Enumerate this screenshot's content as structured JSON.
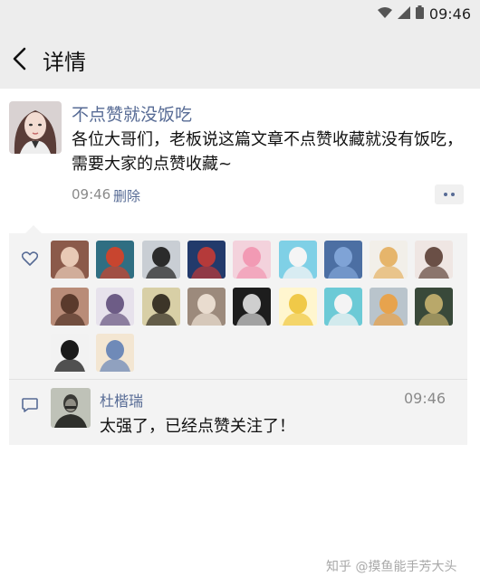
{
  "status_bar": {
    "time": "09:46",
    "icons": [
      "wifi-icon",
      "signal-icon",
      "battery-icon"
    ]
  },
  "header": {
    "title": "详情",
    "back_icon": "chevron-left-icon"
  },
  "post": {
    "author": "不点赞就没饭吃",
    "content": "各位大哥们，老板说这篇文章不点赞收藏就没有饭吃，需要大家的点赞收藏~",
    "time": "09:46",
    "delete_label": "删除",
    "more_icon": "more-dots-icon"
  },
  "likes": {
    "icon": "heart-icon",
    "likers": [
      {
        "name": "liker-1",
        "bg": "#8b5a4a",
        "fg": "#e8c9b5"
      },
      {
        "name": "liker-2",
        "bg": "#2f6e82",
        "fg": "#c8452f"
      },
      {
        "name": "liker-3",
        "bg": "#c9ced4",
        "fg": "#2b2b2b"
      },
      {
        "name": "liker-4",
        "bg": "#223a6b",
        "fg": "#b53a3a"
      },
      {
        "name": "liker-5",
        "bg": "#f3d2dc",
        "fg": "#f29ab4"
      },
      {
        "name": "liker-6",
        "bg": "#7fd0e6",
        "fg": "#f5f5f5"
      },
      {
        "name": "liker-7",
        "bg": "#4c6fa3",
        "fg": "#7fa3d6"
      },
      {
        "name": "liker-8",
        "bg": "#f2efe9",
        "fg": "#e6b56b"
      },
      {
        "name": "liker-9",
        "bg": "#efe6e3",
        "fg": "#6a4f46"
      },
      {
        "name": "liker-10",
        "bg": "#b98c78",
        "fg": "#5a3a2c"
      },
      {
        "name": "liker-11",
        "bg": "#e7e2ec",
        "fg": "#6d5c86"
      },
      {
        "name": "liker-12",
        "bg": "#d8cfa6",
        "fg": "#3c3528"
      },
      {
        "name": "liker-13",
        "bg": "#9c8a7c",
        "fg": "#e9dccf"
      },
      {
        "name": "liker-14",
        "bg": "#1d1d1d",
        "fg": "#cfcfcf"
      },
      {
        "name": "liker-15",
        "bg": "#fff6cf",
        "fg": "#f0c948"
      },
      {
        "name": "liker-16",
        "bg": "#6ccad6",
        "fg": "#f4f4f4"
      },
      {
        "name": "liker-17",
        "bg": "#b9c4cc",
        "fg": "#e7a34d"
      },
      {
        "name": "liker-18",
        "bg": "#39493a",
        "fg": "#b9a86a"
      },
      {
        "name": "liker-19",
        "bg": "#f2f2f2",
        "fg": "#1a1a1a"
      },
      {
        "name": "liker-20",
        "bg": "#f3e6d2",
        "fg": "#6f8ab8"
      }
    ]
  },
  "comment": {
    "icon": "comment-bubble-icon",
    "author": "杜楷瑞",
    "time": "09:46",
    "text": "太强了，已经点赞关注了！"
  },
  "watermark": "知乎 @摸鱼能手芳大头",
  "colors": {
    "link": "#576b95",
    "panel": "#f3f3f3",
    "bar": "#ededed"
  }
}
